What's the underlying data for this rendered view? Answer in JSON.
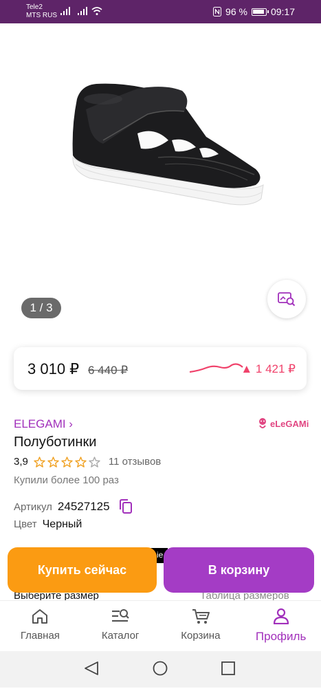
{
  "status_bar": {
    "carrier_1": "Tele2",
    "carrier_2": "MTS RUS",
    "battery": "96 %",
    "time": "09:17"
  },
  "gallery": {
    "counter": "1 / 3"
  },
  "price": {
    "current": "3 010 ₽",
    "old": "6 440 ₽",
    "change": "▲ 1 421 ₽"
  },
  "product": {
    "brand_link": "ELEGAMI ›",
    "brand_logo_text": "eLeGAMi",
    "title": "Полуботинки",
    "rating": "3,9",
    "stars_filled": 4,
    "stars_total": 5,
    "reviews": "11 отзывов",
    "bought": "Купили более 100 раз",
    "article_label": "Артикул",
    "article_value": "24527125",
    "color_label": "Цвет",
    "color_value": "Черный"
  },
  "size": {
    "choose_label": "Выберите размер",
    "table_label": "Таблица размеров"
  },
  "badge_partial": "ie",
  "actions": {
    "buy_now": "Купить сейчас",
    "add_to_cart": "В корзину"
  },
  "bottom_nav": [
    {
      "label": "Главная",
      "icon": "home-icon",
      "active": false
    },
    {
      "label": "Каталог",
      "icon": "catalog-search-icon",
      "active": false
    },
    {
      "label": "Корзина",
      "icon": "cart-icon",
      "active": false
    },
    {
      "label": "Профиль",
      "icon": "profile-icon",
      "active": true
    }
  ],
  "colors": {
    "status_bar": "#5e2468",
    "brand_purple": "#a12fbb",
    "buy_now_orange": "#fb9b12",
    "cart_purple": "#a43cc5",
    "price_up_pink": "#f0426b",
    "star_orange": "#f0a020"
  }
}
